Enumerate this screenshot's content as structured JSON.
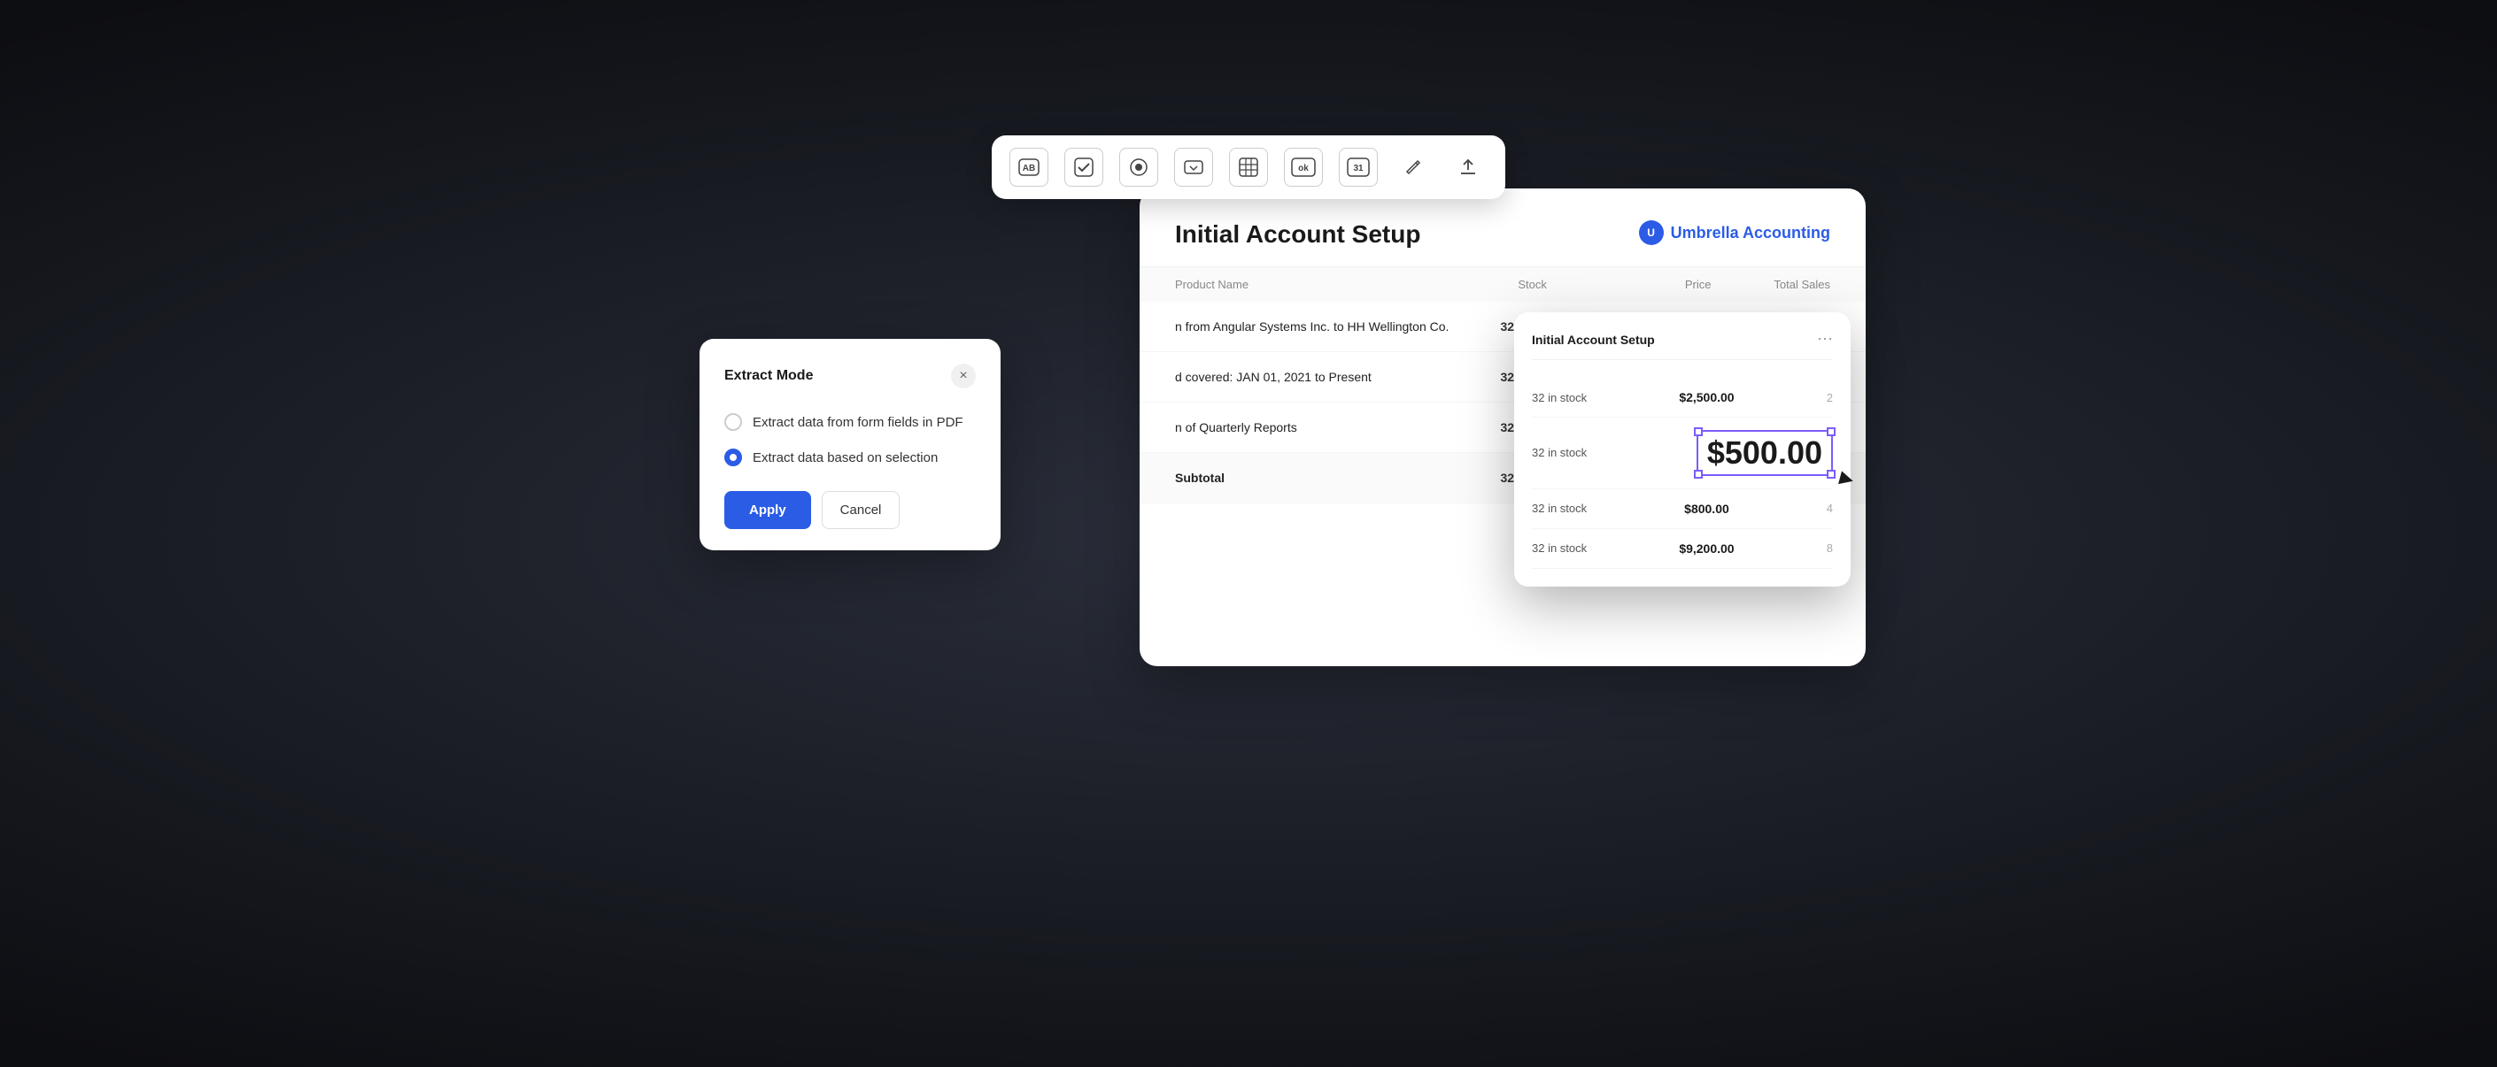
{
  "toolbar": {
    "icons": [
      {
        "name": "text-icon",
        "symbol": "AB",
        "bordered": true
      },
      {
        "name": "checkbox-icon",
        "symbol": "✓",
        "bordered": true
      },
      {
        "name": "circle-icon",
        "symbol": "⊙",
        "bordered": true
      },
      {
        "name": "dropdown-icon",
        "symbol": "⊡",
        "bordered": true
      },
      {
        "name": "table-icon",
        "symbol": "⊞",
        "bordered": true
      },
      {
        "name": "ok-icon",
        "symbol": "ok",
        "bordered": true
      },
      {
        "name": "calendar-icon",
        "symbol": "31",
        "bordered": true
      },
      {
        "name": "share-icon",
        "symbol": "↗",
        "bordered": false
      },
      {
        "name": "upload-icon",
        "symbol": "↑",
        "bordered": false
      }
    ]
  },
  "doc": {
    "title": "Initial Account Setup",
    "brand": "Umbrella Accounting",
    "table": {
      "headers": [
        "Product Name",
        "Stock",
        "Price",
        "Total Sales"
      ],
      "rows": [
        {
          "product": "n from Angular Systems Inc. to HH Wellington Co.",
          "stock": "32 in stock",
          "price": "$2,500.00",
          "total": ""
        },
        {
          "product": "d covered: JAN 01, 2021 to Present",
          "stock": "32 in stock",
          "price": "$500.00",
          "total": ""
        },
        {
          "product": "n of Quarterly Reports",
          "stock": "32 in stock",
          "price": "$800.00",
          "total": ""
        }
      ],
      "subtotal": {
        "label": "Subtotal",
        "stock": "32 in stock",
        "price": "$9,200.00"
      }
    }
  },
  "extract_dialog": {
    "title": "Extract Mode",
    "close_label": "×",
    "options": [
      {
        "id": "form-fields",
        "label": "Extract data from form fields in PDF",
        "selected": false
      },
      {
        "id": "selection",
        "label": "Extract data based on selection",
        "selected": true
      }
    ],
    "apply_label": "Apply",
    "cancel_label": "Cancel"
  },
  "right_panel": {
    "title": "Initial Account Setup",
    "menu_label": "⋯",
    "rows": [
      {
        "stock": "32 in stock",
        "price": "$2,500.00",
        "num": "2"
      },
      {
        "stock": "32 in stock",
        "price": "$500.00",
        "num": "",
        "highlighted": true
      },
      {
        "stock": "32 in stock",
        "price": "$800.00",
        "num": "4"
      },
      {
        "stock": "32 in stock",
        "price": "$9,200.00",
        "num": "8"
      }
    ],
    "highlighted_value": "$500.00"
  }
}
